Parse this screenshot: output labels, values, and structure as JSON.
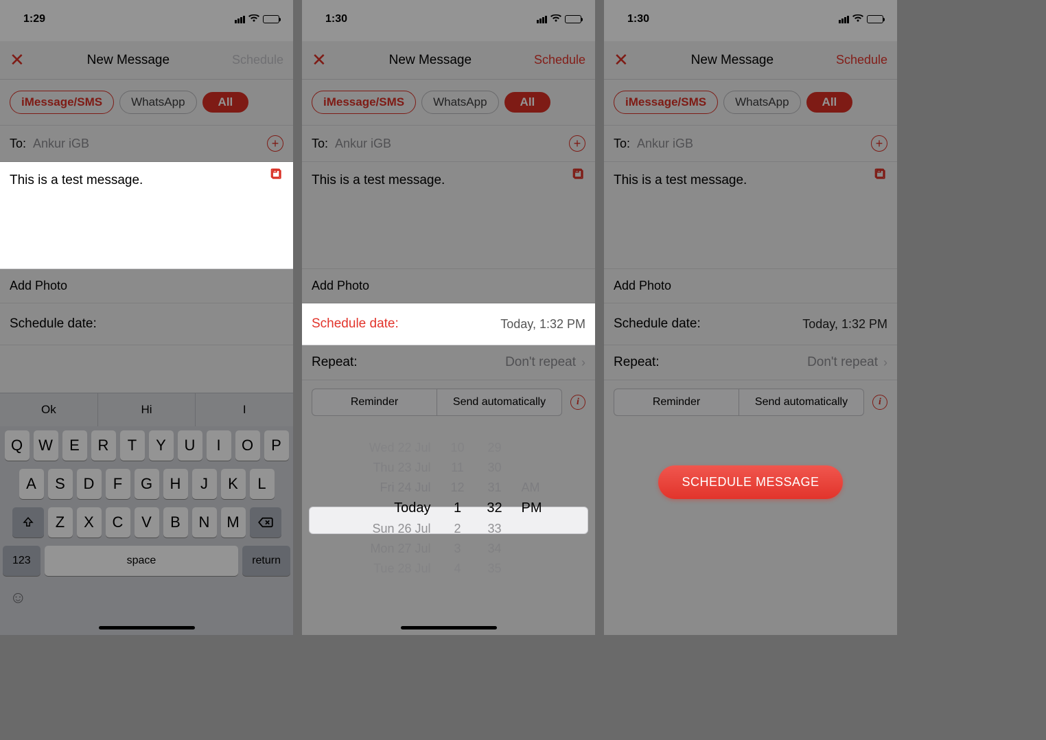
{
  "statusbar": {
    "time1": "1:29",
    "time2": "1:30",
    "time3": "1:30"
  },
  "nav": {
    "title": "New Message",
    "schedule": "Schedule"
  },
  "chips": {
    "imsg": "iMessage/SMS",
    "wa": "WhatsApp",
    "all": "All"
  },
  "recipient": {
    "label": "To:",
    "name": "Ankur iGB"
  },
  "message": "This is a test message.",
  "sections": {
    "addphoto": "Add Photo",
    "schedule_label": "Schedule date:",
    "schedule_value": "Today, 1:32 PM",
    "repeat_label": "Repeat:",
    "repeat_value": "Don't repeat",
    "reminder": "Reminder",
    "send_auto": "Send automatically"
  },
  "big_button": "SCHEDULE MESSAGE",
  "keyboard": {
    "suggestions": [
      "Ok",
      "Hi",
      "I"
    ],
    "row1": [
      "Q",
      "W",
      "E",
      "R",
      "T",
      "Y",
      "U",
      "I",
      "O",
      "P"
    ],
    "row2": [
      "A",
      "S",
      "D",
      "F",
      "G",
      "H",
      "J",
      "K",
      "L"
    ],
    "row3": [
      "Z",
      "X",
      "C",
      "V",
      "B",
      "N",
      "M"
    ],
    "num": "123",
    "space": "space",
    "return": "return"
  },
  "picker": {
    "rows": [
      {
        "day": "Wed 22 Jul",
        "h": "10",
        "m": "29",
        "ap": ""
      },
      {
        "day": "Thu 23 Jul",
        "h": "11",
        "m": "30",
        "ap": ""
      },
      {
        "day": "Fri 24 Jul",
        "h": "12",
        "m": "31",
        "ap": "AM"
      },
      {
        "day": "Today",
        "h": "1",
        "m": "32",
        "ap": "PM"
      },
      {
        "day": "Sun 26 Jul",
        "h": "2",
        "m": "33",
        "ap": ""
      },
      {
        "day": "Mon 27 Jul",
        "h": "3",
        "m": "34",
        "ap": ""
      },
      {
        "day": "Tue 28 Jul",
        "h": "4",
        "m": "35",
        "ap": ""
      }
    ],
    "selected_index": 3
  }
}
